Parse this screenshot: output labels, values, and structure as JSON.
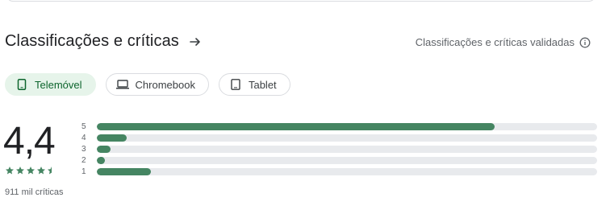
{
  "header": {
    "title": "Classificações e críticas",
    "arrow_icon": "arrow-right-icon",
    "verified_link": "Classificações e críticas validadas",
    "info_icon": "info-icon"
  },
  "device_chips": [
    {
      "label": "Telemóvel",
      "icon": "phone-icon",
      "selected": true
    },
    {
      "label": "Chromebook",
      "icon": "laptop-icon",
      "selected": false
    },
    {
      "label": "Tablet",
      "icon": "tablet-icon",
      "selected": false
    }
  ],
  "rating": {
    "score": "4,4",
    "stars": 4.5,
    "review_count": "911 mil críticas"
  },
  "histogram": [
    {
      "label": "5",
      "fraction": 0.795
    },
    {
      "label": "4",
      "fraction": 0.06
    },
    {
      "label": "3",
      "fraction": 0.028
    },
    {
      "label": "2",
      "fraction": 0.016
    },
    {
      "label": "1",
      "fraction": 0.108
    }
  ],
  "colors": {
    "accent": "#458562",
    "chip_selected_bg": "#e6f4ea",
    "chip_selected_text": "#0d652d",
    "track": "#e8eaed"
  }
}
